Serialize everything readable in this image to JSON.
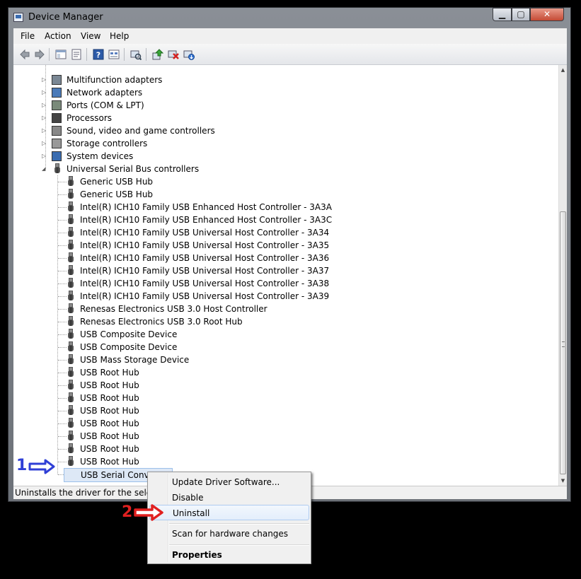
{
  "window": {
    "title": "Device Manager"
  },
  "menu": [
    "File",
    "Action",
    "View",
    "Help"
  ],
  "toolbar_icons": [
    "back-arrow-icon",
    "forward-arrow-icon",
    "show-hide-console-tree-icon",
    "properties-icon",
    "help-icon",
    "view-icon",
    "scan-hardware-icon",
    "update-driver-icon",
    "uninstall-icon",
    "enable-device-icon"
  ],
  "tree": {
    "categories_above": [
      {
        "label": "Multifunction adapters",
        "icon": "multifunction-adapter-icon"
      },
      {
        "label": "Network adapters",
        "icon": "network-adapter-icon"
      },
      {
        "label": "Ports (COM & LPT)",
        "icon": "ports-icon"
      },
      {
        "label": "Processors",
        "icon": "processor-icon"
      },
      {
        "label": "Sound, video and game controllers",
        "icon": "sound-icon"
      },
      {
        "label": "Storage controllers",
        "icon": "storage-controller-icon"
      },
      {
        "label": "System devices",
        "icon": "system-devices-icon"
      }
    ],
    "usb_category": {
      "label": "Universal Serial Bus controllers",
      "icon": "usb-icon"
    },
    "usb_devices": [
      "Generic USB Hub",
      "Generic USB Hub",
      "Intel(R) ICH10 Family USB Enhanced Host Controller - 3A3A",
      "Intel(R) ICH10 Family USB Enhanced Host Controller - 3A3C",
      "Intel(R) ICH10 Family USB Universal Host Controller - 3A34",
      "Intel(R) ICH10 Family USB Universal Host Controller - 3A35",
      "Intel(R) ICH10 Family USB Universal Host Controller - 3A36",
      "Intel(R) ICH10 Family USB Universal Host Controller - 3A37",
      "Intel(R) ICH10 Family USB Universal Host Controller - 3A38",
      "Intel(R) ICH10 Family USB Universal Host Controller - 3A39",
      "Renesas Electronics USB 3.0 Host Controller",
      "Renesas Electronics USB 3.0 Root Hub",
      "USB Composite Device",
      "USB Composite Device",
      "USB Mass Storage Device",
      "USB Root Hub",
      "USB Root Hub",
      "USB Root Hub",
      "USB Root Hub",
      "USB Root Hub",
      "USB Root Hub",
      "USB Root Hub",
      "USB Root Hub",
      "USB Serial Converter"
    ],
    "selected_device": "USB Serial Converter"
  },
  "status": {
    "text": "Uninstalls the driver for the selected"
  },
  "context_menu": {
    "items": [
      {
        "label": "Update Driver Software...",
        "bold": false
      },
      {
        "label": "Disable",
        "bold": false
      },
      {
        "label": "Uninstall",
        "bold": false,
        "highlighted": true
      },
      {
        "label": "Scan for hardware changes",
        "bold": false
      },
      {
        "label": "Properties",
        "bold": true
      }
    ]
  },
  "annotations": [
    {
      "number": "1",
      "color": "#2f3fd6"
    },
    {
      "number": "2",
      "color": "#e02020"
    }
  ]
}
